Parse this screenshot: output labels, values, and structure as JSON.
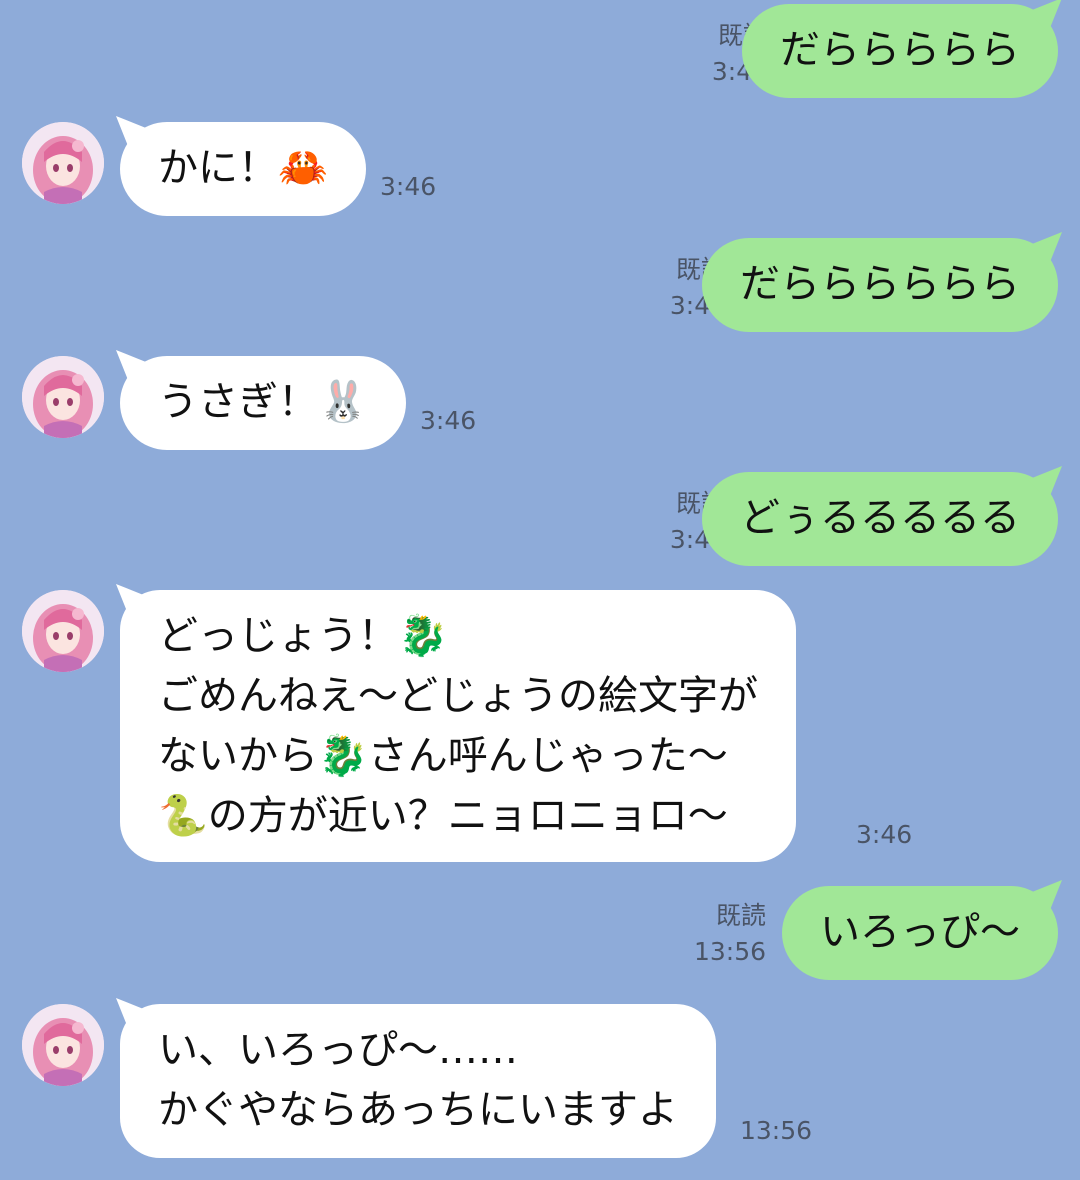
{
  "colors": {
    "background": "#8eabd9",
    "sent_bubble": "#a1e797",
    "received_bubble": "#ffffff",
    "meta_text": "#4a5466"
  },
  "contact": {
    "avatar_icon": "anime-girl-avatar-icon"
  },
  "messages": [
    {
      "side": "sent",
      "text": "だららららら",
      "read": "既読",
      "time": "3:46"
    },
    {
      "side": "received",
      "text": "かに！🦀",
      "time": "3:46"
    },
    {
      "side": "sent",
      "text": "だらららららら",
      "read": "既読",
      "time": "3:46"
    },
    {
      "side": "received",
      "text": "うさぎ！🐰",
      "time": "3:46"
    },
    {
      "side": "sent",
      "text": "どぅるるるるる",
      "read": "既読",
      "time": "3:46"
    },
    {
      "side": "received",
      "text": "どっじょう！🐉\nごめんねえ〜どじょうの絵文字が\nないから🐉さん呼んじゃった〜\n🐍の方が近い？ニョロニョロ〜",
      "time": "3:46"
    },
    {
      "side": "sent",
      "text": "いろっぴ〜",
      "read": "既読",
      "time": "13:56"
    },
    {
      "side": "received",
      "text": "い、いろっぴ〜……\nかぐやならあっちにいますよ",
      "time": "13:56"
    }
  ]
}
